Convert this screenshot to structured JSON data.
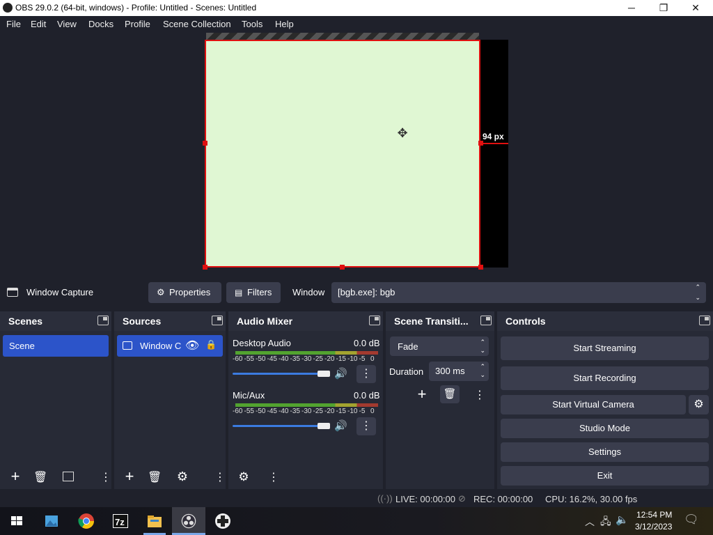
{
  "window": {
    "title": "OBS 29.0.2 (64-bit, windows) - Profile: Untitled - Scenes: Untitled",
    "minimize": "─",
    "maximize": "❐",
    "close": "✕"
  },
  "menu": [
    "File",
    "Edit",
    "View",
    "Docks",
    "Profile",
    "Scene Collection",
    "Tools",
    "Help"
  ],
  "preview": {
    "distance_label": "94 px"
  },
  "source_toolbar": {
    "source_name": "Window Capture",
    "properties_label": "Properties",
    "filters_label": "Filters",
    "window_label": "Window",
    "window_value": "[bgb.exe]: bgb"
  },
  "scenes": {
    "title": "Scenes",
    "items": [
      "Scene"
    ]
  },
  "sources": {
    "title": "Sources",
    "items": [
      "Window C"
    ]
  },
  "audio_mixer": {
    "title": "Audio Mixer",
    "channels": [
      {
        "name": "Desktop Audio",
        "level": "0.0 dB",
        "volume": 0.95
      },
      {
        "name": "Mic/Aux",
        "level": "0.0 dB",
        "volume": 0.95
      }
    ],
    "scale": [
      "-60",
      "-55",
      "-50",
      "-45",
      "-40",
      "-35",
      "-30",
      "-25",
      "-20",
      "-15",
      "-10",
      "-5",
      "0"
    ]
  },
  "transitions": {
    "title": "Scene Transiti...",
    "selected": "Fade",
    "duration_label": "Duration",
    "duration_value": "300 ms"
  },
  "controls": {
    "title": "Controls",
    "start_streaming": "Start Streaming",
    "start_recording": "Start Recording",
    "start_virtual_camera": "Start Virtual Camera",
    "studio_mode": "Studio Mode",
    "settings": "Settings",
    "exit": "Exit"
  },
  "status": {
    "live": "LIVE: 00:00:00",
    "rec": "REC: 00:00:00",
    "cpu": "CPU: 16.2%, 30.00 fps"
  },
  "taskbar": {
    "time": "12:54 PM",
    "date": "3/12/2023",
    "apps": [
      "start-icon",
      "photos-icon",
      "chrome-icon",
      "7zip-icon",
      "file-explorer-icon",
      "obs-icon",
      "gamepad-icon"
    ]
  },
  "colors": {
    "accent": "#2c54c9",
    "selection": "#e01010",
    "capture_fill": "#e0f7d3"
  }
}
